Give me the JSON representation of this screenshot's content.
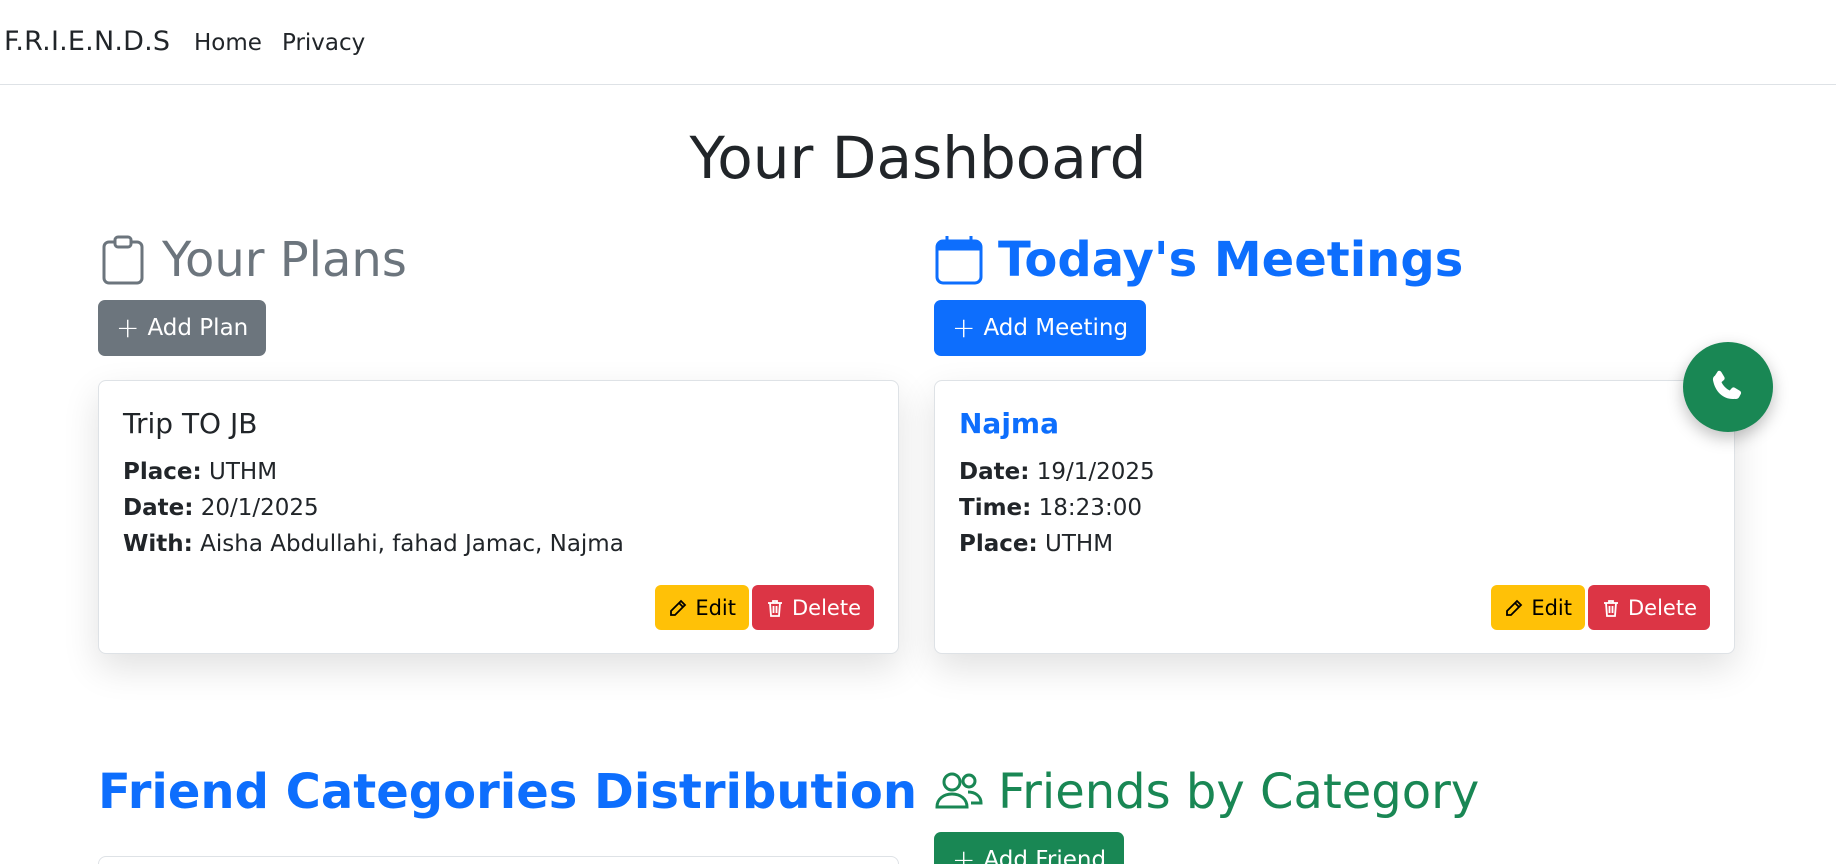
{
  "navbar": {
    "brand": "F.R.I.E.N.D.S",
    "links": [
      "Home",
      "Privacy"
    ]
  },
  "page": {
    "title": "Your Dashboard"
  },
  "plans": {
    "heading": "Your Plans",
    "add_label": "Add Plan",
    "card": {
      "title": "Trip TO JB",
      "place_label": "Place:",
      "place": "UTHM",
      "date_label": "Date:",
      "date": "20/1/2025",
      "with_label": "With:",
      "with": "Aisha Abdullahi, fahad Jamac, Najma",
      "edit_label": "Edit",
      "delete_label": "Delete"
    }
  },
  "meetings": {
    "heading": "Today's Meetings",
    "add_label": "Add Meeting",
    "card": {
      "title": "Najma",
      "date_label": "Date:",
      "date": "19/1/2025",
      "time_label": "Time:",
      "time": "18:23:00",
      "place_label": "Place:",
      "place": "UTHM",
      "edit_label": "Edit",
      "delete_label": "Delete"
    }
  },
  "distribution": {
    "heading": "Friend Categories Distribution"
  },
  "friends": {
    "heading": "Friends by Category",
    "add_label": "Add Friend"
  },
  "colors": {
    "primary": "#0d6efd",
    "secondary": "#6c757d",
    "success": "#198754",
    "warning": "#ffc107",
    "danger": "#dc3545"
  },
  "icons": {
    "plans": "clipboard-icon",
    "meetings": "calendar-icon",
    "friends": "people-icon",
    "edit": "pencil-icon",
    "delete": "trash-icon",
    "fab": "phone-icon"
  }
}
